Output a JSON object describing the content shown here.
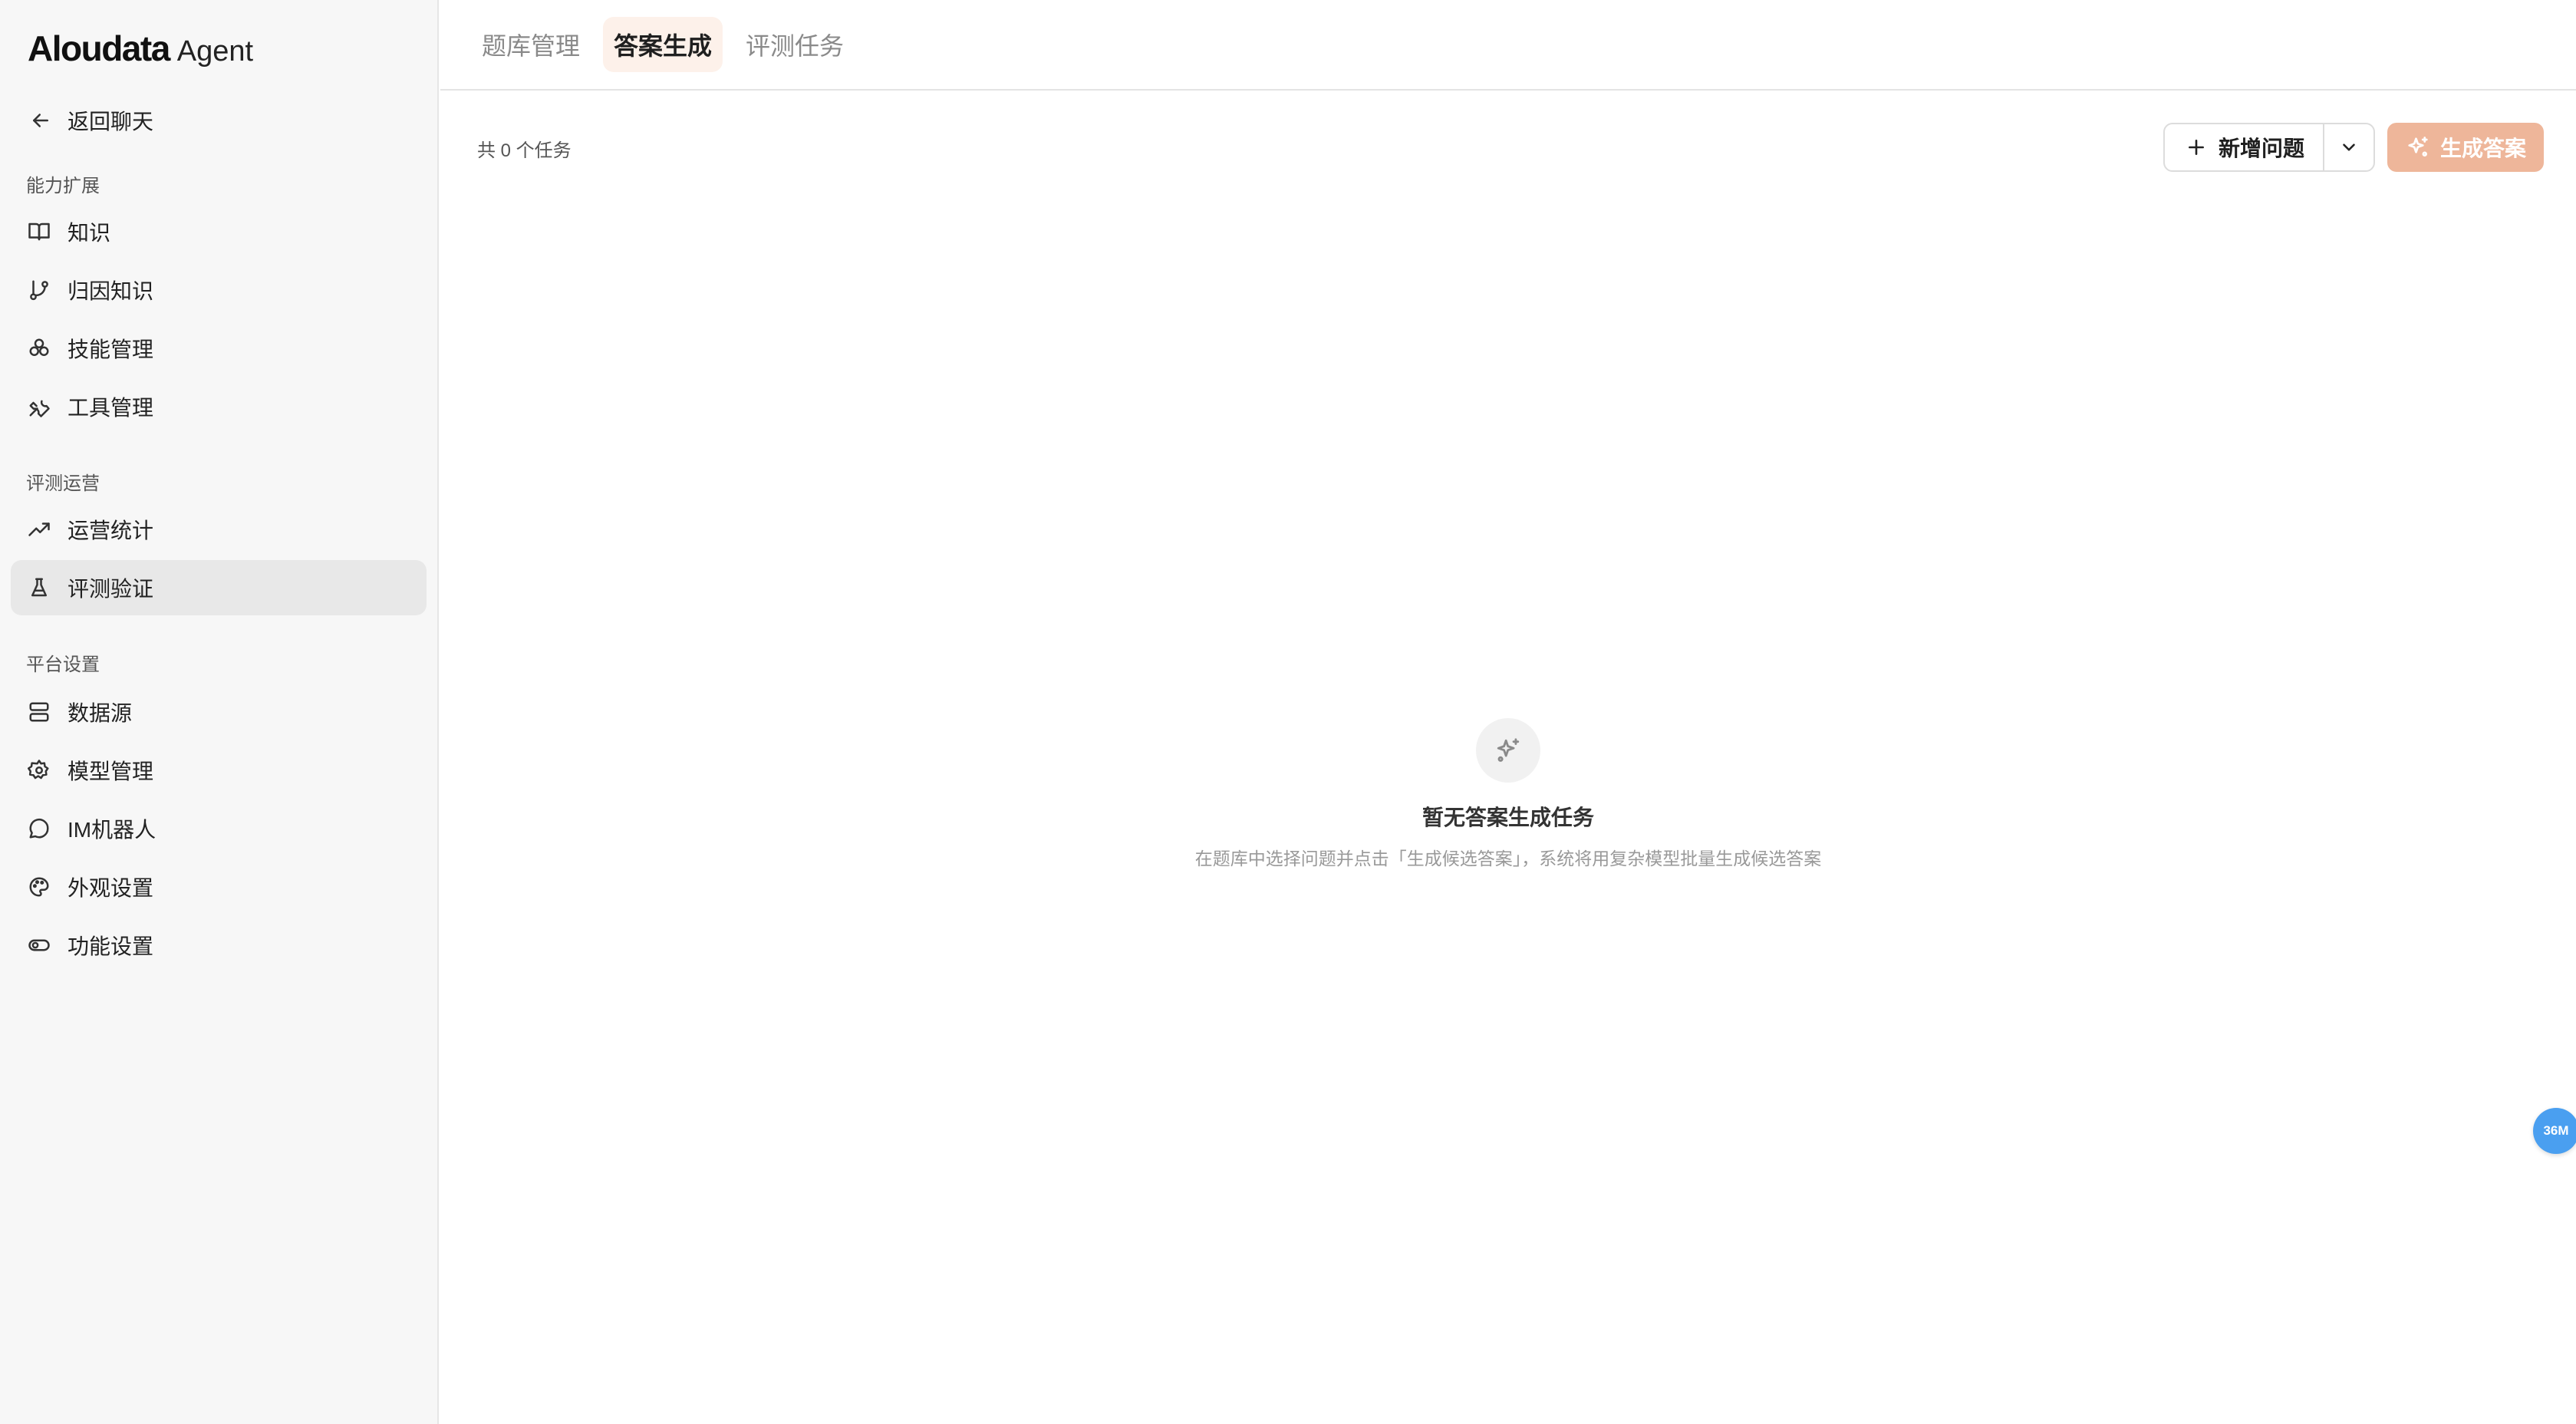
{
  "brand": {
    "name": "Aloudata",
    "suffix": "Agent"
  },
  "back": {
    "label": "返回聊天",
    "icon": "arrow-left-icon"
  },
  "sidebar": {
    "sections": [
      {
        "title": "能力扩展",
        "items": [
          {
            "label": "知识",
            "icon": "book-icon"
          },
          {
            "label": "归因知识",
            "icon": "git-branch-icon"
          },
          {
            "label": "技能管理",
            "icon": "cubes-icon"
          },
          {
            "label": "工具管理",
            "icon": "wrench-icon"
          }
        ]
      },
      {
        "title": "评测运营",
        "items": [
          {
            "label": "运营统计",
            "icon": "trending-up-icon"
          },
          {
            "label": "评测验证",
            "icon": "flask-icon",
            "active": true
          }
        ]
      },
      {
        "title": "平台设置",
        "items": [
          {
            "label": "数据源",
            "icon": "server-icon"
          },
          {
            "label": "模型管理",
            "icon": "gear-icon"
          },
          {
            "label": "IM机器人",
            "icon": "chat-bubble-icon"
          },
          {
            "label": "外观设置",
            "icon": "palette-icon"
          },
          {
            "label": "功能设置",
            "icon": "toggle-icon"
          }
        ]
      }
    ]
  },
  "tabs": [
    {
      "label": "题库管理"
    },
    {
      "label": "答案生成",
      "active": true
    },
    {
      "label": "评测任务"
    }
  ],
  "toolbar": {
    "task_count": "共 0 个任务",
    "add_label": "新增问题",
    "generate_label": "生成答案"
  },
  "empty_state": {
    "icon": "sparkles-icon",
    "title": "暂无答案生成任务",
    "description": "在题库中选择问题并点击「生成候选答案」，系统将用复杂模型批量生成候选答案"
  },
  "float_badge": {
    "label": "36M"
  },
  "colors": {
    "accent": "#eeb69a",
    "active_tab_bg": "#fdf1ea",
    "sidebar_bg": "#f7f7f7",
    "active_nav_bg": "#e8e8e8",
    "badge": "#4a9ff0"
  }
}
